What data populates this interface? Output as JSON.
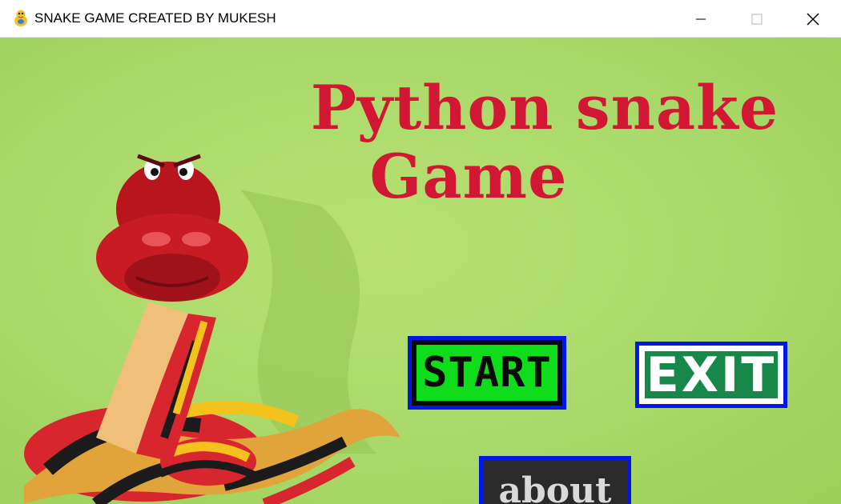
{
  "window": {
    "title": "SNAKE GAME CREATED BY MUKESH",
    "app_icon": "pygame-snake-icon"
  },
  "game": {
    "title_line1": "Python snake",
    "title_line2": "Game",
    "background_color": "#a9d96a",
    "title_color": "#d11733",
    "buttons": {
      "start": "START",
      "exit": "EXIT",
      "about": "about"
    }
  }
}
